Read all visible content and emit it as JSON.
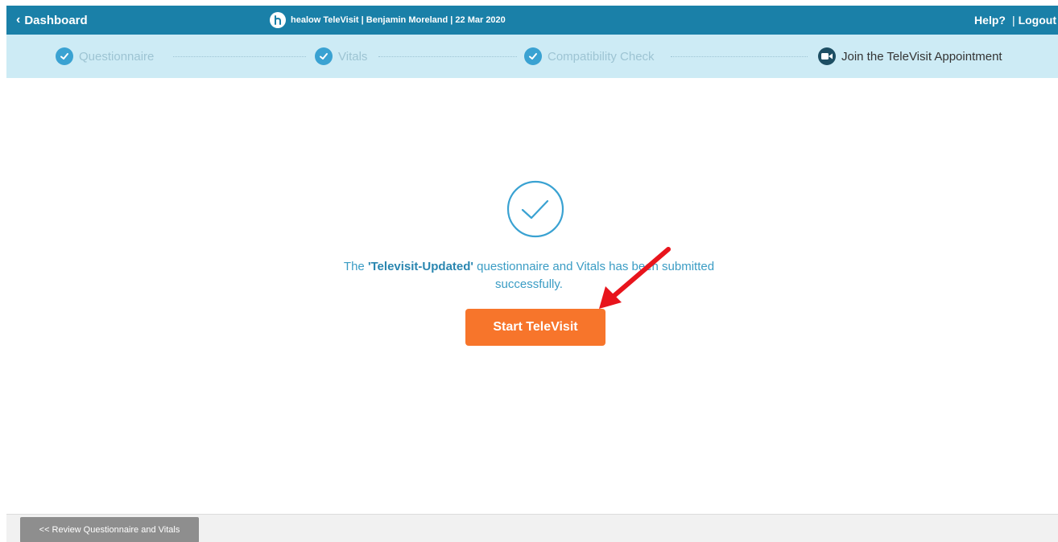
{
  "header": {
    "back_label": "Dashboard",
    "title": "healow TeleVisit | Benjamin Moreland | 22 Mar 2020",
    "help_label": "Help?",
    "separator": "|",
    "logout_label": "Logout"
  },
  "steps": [
    {
      "label": "Questionnaire",
      "icon": "check-circle-icon",
      "state": "done"
    },
    {
      "label": "Vitals",
      "icon": "check-circle-icon",
      "state": "done"
    },
    {
      "label": "Compatibility Check",
      "icon": "check-circle-icon",
      "state": "done"
    },
    {
      "label": "Join the TeleVisit Appointment",
      "icon": "video-camera-icon",
      "state": "current"
    }
  ],
  "main": {
    "message_prefix": "The ",
    "questionnaire_name": "'Televisit-Updated'",
    "message_suffix": " questionnaire and Vitals has been submitted successfully.",
    "start_button_label": "Start TeleVisit"
  },
  "footer": {
    "review_button_label": "<< Review Questionnaire and Vitals"
  },
  "colors": {
    "header_bg": "#1a80a8",
    "steps_bg": "#cdebf5",
    "accent": "#3aa2d2",
    "start_button": "#f7752b",
    "annotation_arrow": "#e8141c"
  }
}
